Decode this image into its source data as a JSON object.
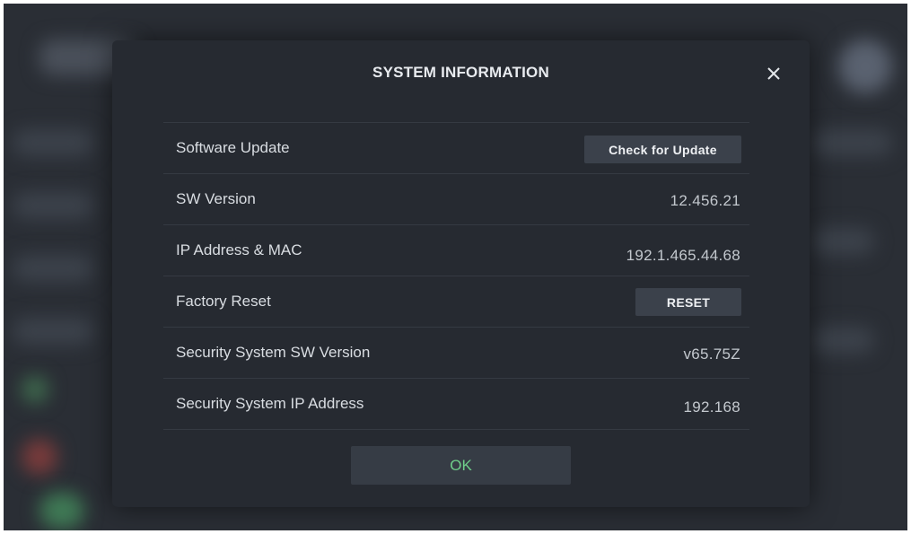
{
  "dialog": {
    "title": "SYSTEM INFORMATION",
    "close_icon": "close-icon",
    "rows": [
      {
        "label": "Software Update",
        "button": "Check for Update"
      },
      {
        "label": "SW Version",
        "value": "12.456.21"
      },
      {
        "label": "IP Address & MAC",
        "value": "192.1.465.44.68"
      },
      {
        "label": "Factory Reset",
        "button": "RESET"
      },
      {
        "label": "Security System SW Version",
        "value": "v65.75Z"
      },
      {
        "label": "Security System IP Address",
        "value": "192.168"
      }
    ],
    "ok_label": "OK"
  },
  "colors": {
    "dialog_bg": "#262a31",
    "ok_text": "#6fcf8a",
    "button_bg": "#3b414b"
  }
}
